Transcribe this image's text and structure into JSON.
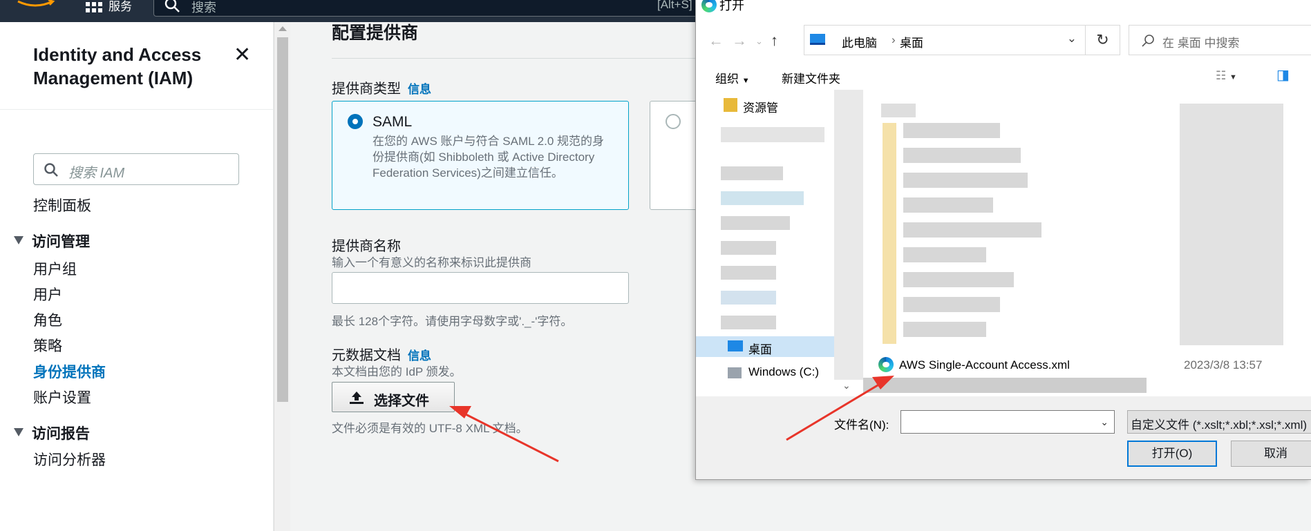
{
  "topnav": {
    "services_label": "服务",
    "search_placeholder": "搜索",
    "search_shortcut": "[Alt+S]"
  },
  "sidebar": {
    "title": "Identity and Access Management (IAM)",
    "search_placeholder": "搜索 IAM",
    "dashboard": "控制面板",
    "section_access_mgmt": "访问管理",
    "items": [
      "用户组",
      "用户",
      "角色",
      "策略",
      "身份提供商",
      "账户设置"
    ],
    "active_item": "身份提供商",
    "section_access_reports": "访问报告",
    "report_items": [
      "访问分析器"
    ]
  },
  "main": {
    "heading": "配置提供商",
    "provider_type_label": "提供商类型",
    "info_link": "信息",
    "saml": {
      "title": "SAML",
      "description": "在您的 AWS 账户与符合 SAML 2.0 规范的身份提供商(如 Shibboleth 或 Active Directory Federation Services)之间建立信任。"
    },
    "provider_name_label": "提供商名称",
    "provider_name_hint": "输入一个有意义的名称来标识此提供商",
    "provider_name_value": "",
    "provider_name_constraint": "最长 128个字符。请使用字母数字或'._-'字符。",
    "metadata_label": "元数据文档",
    "metadata_hint": "本文档由您的 IdP 颁发。",
    "choose_file_button": "选择文件",
    "metadata_constraint": "文件必须是有效的 UTF-8 XML 文档。"
  },
  "dialog": {
    "title": "打开",
    "breadcrumb": [
      "此电脑",
      "桌面"
    ],
    "search_placeholder": "在 桌面 中搜索",
    "organize": "组织",
    "new_folder": "新建文件夹",
    "tree_items": [
      "资源管",
      "桌面",
      "Windows (C:)"
    ],
    "file": {
      "name": "AWS Single-Account Access.xml",
      "date": "2023/3/8 13:57"
    },
    "filename_label": "文件名(N):",
    "filename_value": "",
    "filter": "自定义文件 (*.xslt;*.xbl;*.xsl;*.xml)",
    "open_button": "打开(O)",
    "cancel_button": "取消"
  },
  "colors": {
    "aws_nav": "#232f3e",
    "link": "#0073bb",
    "annotation_arrow": "#e8352a"
  }
}
